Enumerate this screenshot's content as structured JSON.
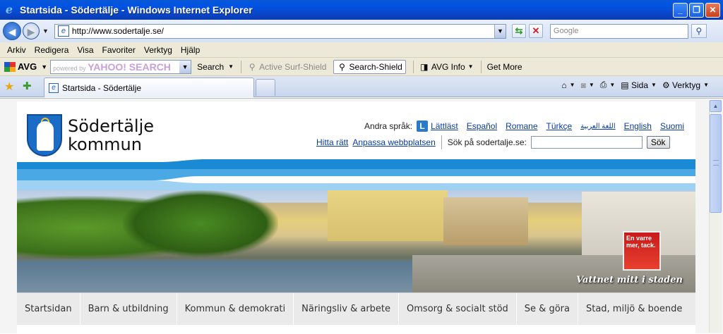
{
  "window": {
    "title": "Startsida - Södertälje - Windows Internet Explorer",
    "icon": "ie-logo-icon"
  },
  "address_bar": {
    "url": "http://www.sodertalje.se/",
    "search_placeholder": "Google"
  },
  "menu": {
    "items": [
      {
        "label": "Arkiv",
        "access_key": "A"
      },
      {
        "label": "Redigera",
        "access_key": "R"
      },
      {
        "label": "Visa",
        "access_key": "s"
      },
      {
        "label": "Favoriter",
        "access_key": "F"
      },
      {
        "label": "Verktyg",
        "access_key": "V"
      },
      {
        "label": "Hjälp",
        "access_key": "H"
      }
    ]
  },
  "avg_toolbar": {
    "logo": "AVG",
    "search_placeholder_prefix": "powered by",
    "search_placeholder_brand": "YAHOO! SEARCH",
    "search_label": "Search",
    "active_surf_shield": "Active  Surf-Shield",
    "search_shield": "Search-Shield",
    "avg_info": "AVG Info",
    "get_more": "Get More"
  },
  "tabs": {
    "active_tab": "Startsida - Södertälje"
  },
  "command_bar": {
    "page": "Sida",
    "tools": "Verktyg"
  },
  "page": {
    "logo_line1": "Södertälje",
    "logo_line2": "kommun",
    "languages_label": "Andra språk:",
    "languages": [
      "Lättläst",
      "Español",
      "Romane",
      "Türkçe",
      "اللغة العربية",
      "English",
      "Suomi"
    ],
    "links": [
      "Hitta rätt",
      "Anpassa webbplatsen"
    ],
    "search_label": "Sök på sodertalje.se:",
    "search_button": "Sök",
    "banner_caption": "Vattnet mitt i staden",
    "banner_ad_text": "En varre mer, tack.",
    "nav": [
      "Startsidan",
      "Barn & utbildning",
      "Kommun & demokrati",
      "Näringsliv & arbete",
      "Omsorg & socialt stöd",
      "Se & göra",
      "Stad, miljö & boende"
    ]
  },
  "colors": {
    "accent_blue": "#1a8ad4",
    "link": "#0a3c9e",
    "titlebar": "#0054e3"
  }
}
